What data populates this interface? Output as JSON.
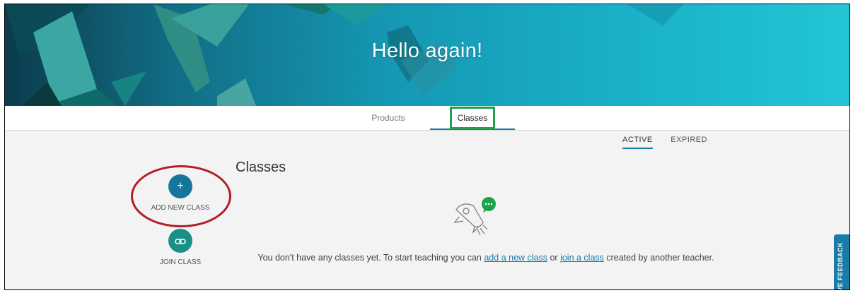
{
  "hero": {
    "title": "Hello again!"
  },
  "tabs": [
    {
      "label": "Products"
    },
    {
      "label": "Classes"
    }
  ],
  "subtabs": [
    {
      "label": "ACTIVE"
    },
    {
      "label": "EXPIRED"
    }
  ],
  "main": {
    "heading": "Classes",
    "add_label": "ADD NEW CLASS",
    "join_label": "JOIN CLASS",
    "empty_prefix": "You don't have any classes yet. To start teaching you can ",
    "empty_link_add": "add a new class",
    "empty_mid": " or ",
    "empty_link_join": "join a class",
    "empty_suffix": " created by another teacher."
  },
  "feedback": {
    "label": "IVE FEEDBACK"
  },
  "colors": {
    "accent": "#1a7aa8",
    "highlight_box": "#1fa34a",
    "annotation": "#b21d26"
  }
}
